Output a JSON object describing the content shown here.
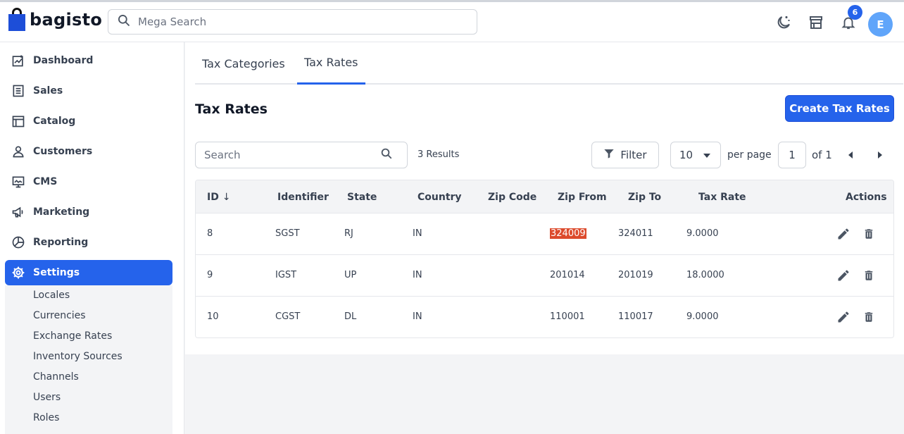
{
  "header": {
    "logo_text": "bagisto",
    "search_placeholder": "Mega Search",
    "notifications_count": "6",
    "avatar_letter": "E"
  },
  "sidebar": {
    "items": [
      {
        "label": "Dashboard",
        "icon": "dashboard-icon"
      },
      {
        "label": "Sales",
        "icon": "sales-icon"
      },
      {
        "label": "Catalog",
        "icon": "catalog-icon"
      },
      {
        "label": "Customers",
        "icon": "customers-icon"
      },
      {
        "label": "CMS",
        "icon": "cms-icon"
      },
      {
        "label": "Marketing",
        "icon": "marketing-icon"
      },
      {
        "label": "Reporting",
        "icon": "reporting-icon"
      },
      {
        "label": "Settings",
        "icon": "settings-icon",
        "active": true
      }
    ],
    "settings_sub": [
      "Locales",
      "Currencies",
      "Exchange Rates",
      "Inventory Sources",
      "Channels",
      "Users",
      "Roles"
    ]
  },
  "tabs": [
    {
      "label": "Tax Categories",
      "active": false
    },
    {
      "label": "Tax Rates",
      "active": true
    }
  ],
  "page": {
    "title": "Tax Rates",
    "create_button": "Create Tax Rates",
    "search_placeholder": "Search",
    "results": "3 Results",
    "filter_label": "Filter",
    "per_page_value": "10",
    "per_page_label": "per page",
    "current_page": "1",
    "of_pages": "of 1"
  },
  "table": {
    "columns": [
      "ID",
      "Identifier",
      "State",
      "Country",
      "Zip Code",
      "Zip From",
      "Zip To",
      "Tax Rate",
      "Actions"
    ],
    "rows": [
      {
        "id": "8",
        "identifier": "SGST",
        "state": "RJ",
        "country": "IN",
        "zip_code": "",
        "zip_from": "324009",
        "zip_to": "324011",
        "tax_rate": "9.0000"
      },
      {
        "id": "9",
        "identifier": "IGST",
        "state": "UP",
        "country": "IN",
        "zip_code": "",
        "zip_from": "201014",
        "zip_to": "201019",
        "tax_rate": "18.0000"
      },
      {
        "id": "10",
        "identifier": "CGST",
        "state": "DL",
        "country": "IN",
        "zip_code": "",
        "zip_from": "110001",
        "zip_to": "110017",
        "tax_rate": "9.0000"
      }
    ]
  },
  "colors": {
    "accent": "#2563eb",
    "highlight": "#dc4a2c"
  }
}
